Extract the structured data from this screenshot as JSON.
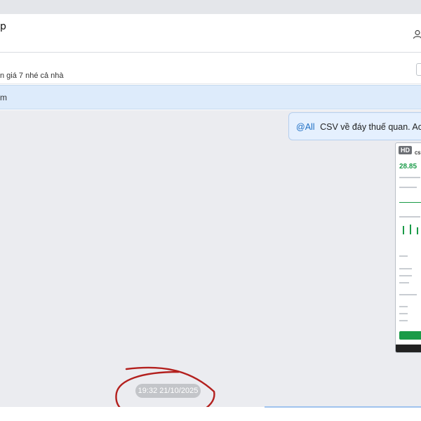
{
  "header": {
    "title": "p"
  },
  "pinned": {
    "text": "n giá 7 nhé cả nhà"
  },
  "notice": {
    "text": "m"
  },
  "messages": [
    {
      "mention": "@All",
      "text": "CSV về đáy thuế quan. Ace"
    }
  ],
  "attachment": {
    "badge": "HD",
    "stock_code": "CS",
    "price": "28.85"
  },
  "timestamp": "19:32 21/10/2025",
  "colors": {
    "chat_bg": "#ebecf0",
    "bubble_bg": "#e5f0fe",
    "mention": "#1f6fc4",
    "notice_bg": "#ddebfb",
    "annotation": "#b3201e"
  },
  "icons": {
    "header_right": "user-icon"
  }
}
